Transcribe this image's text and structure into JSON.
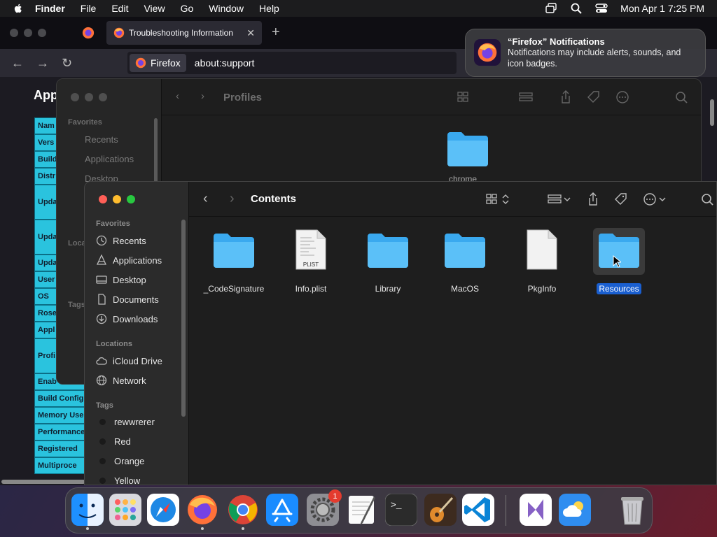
{
  "menubar": {
    "app": "Finder",
    "items": [
      "File",
      "Edit",
      "View",
      "Go",
      "Window",
      "Help"
    ],
    "datetime": "Mon Apr 1  7:25 PM"
  },
  "firefox": {
    "tab_title": "Troubleshooting Information",
    "close_glyph": "✕",
    "newtab_glyph": "+",
    "back_glyph": "←",
    "forward_glyph": "→",
    "reload_glyph": "↻",
    "identity_label": "Firefox",
    "url": "about:support",
    "heading": "App",
    "table_rows": [
      {
        "label": "Nam",
        "h": 24
      },
      {
        "label": "Vers",
        "h": 24
      },
      {
        "label": "Build",
        "h": 24
      },
      {
        "label": "Distr",
        "h": 24
      },
      {
        "label": "Upda",
        "h": 50
      },
      {
        "label": "Upda",
        "h": 50
      },
      {
        "label": "Upda",
        "h": 24
      },
      {
        "label": "User",
        "h": 24
      },
      {
        "label": "OS",
        "h": 24
      },
      {
        "label": "Rose",
        "h": 24
      },
      {
        "label": "Appl",
        "h": 24
      },
      {
        "label": "Profi",
        "h": 50
      },
      {
        "label": "Enab",
        "h": 24
      },
      {
        "label": "Build Config",
        "h": 24
      },
      {
        "label": "Memory Use",
        "h": 24
      },
      {
        "label": "Performance",
        "h": 24
      },
      {
        "label": "Registered",
        "h": 24
      },
      {
        "label": "Multiproce",
        "h": 24
      }
    ]
  },
  "notification": {
    "title": "“Firefox” Notifications",
    "body": "Notifications may include alerts, sounds, and icon badges."
  },
  "finder_back": {
    "title": "Profiles",
    "favorites_header": "Favorites",
    "favorites": [
      "Recents",
      "Applications",
      "Desktop"
    ],
    "locations_header": "Locati",
    "tags_header": "Tags",
    "folder_label": "chrome"
  },
  "finder": {
    "title": "Contents",
    "favorites_header": "Favorites",
    "favorites": [
      "Recents",
      "Applications",
      "Desktop",
      "Documents",
      "Downloads"
    ],
    "locations_header": "Locations",
    "locations": [
      "iCloud Drive",
      "Network"
    ],
    "tags_header": "Tags",
    "tags": [
      {
        "name": "rewwrerer",
        "color": "#1a1a1a"
      },
      {
        "name": "Red",
        "color": "#1a1a1a"
      },
      {
        "name": "Orange",
        "color": "#1a1a1a"
      },
      {
        "name": "Yellow",
        "color": "#1a1a1a"
      }
    ],
    "items": [
      {
        "name": "_CodeSignature",
        "kind": "folder"
      },
      {
        "name": "Info.plist",
        "kind": "plist",
        "badge": "PLIST"
      },
      {
        "name": "Library",
        "kind": "folder"
      },
      {
        "name": "MacOS",
        "kind": "folder"
      },
      {
        "name": "PkgInfo",
        "kind": "file"
      },
      {
        "name": "Resources",
        "kind": "folder",
        "selected": true
      }
    ],
    "accent": "#1a5fd0",
    "folder_color": "#3aa9ef"
  },
  "dock": {
    "apps": [
      "Finder",
      "Launchpad",
      "Safari",
      "Firefox",
      "Chrome",
      "App Store",
      "System Settings",
      "TextEdit",
      "Terminal",
      "GarageBand",
      "Visual Studio Code",
      "Visual Studio",
      "Weather",
      "Trash"
    ],
    "settings_badge": "1",
    "terminal_prompt": ">_"
  }
}
